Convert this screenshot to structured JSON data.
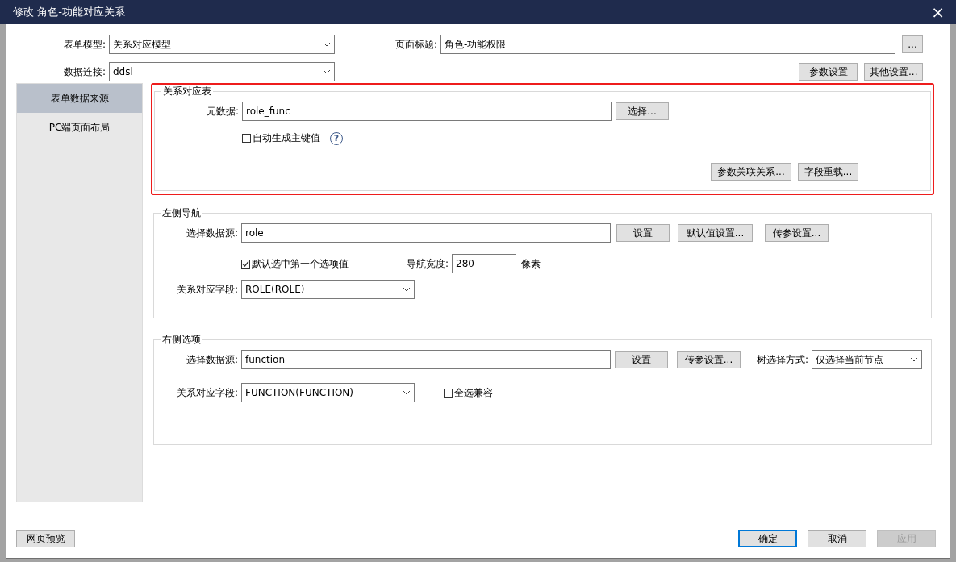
{
  "window": {
    "title": "修改 角色-功能对应关系",
    "close": "×"
  },
  "header": {
    "form_model": {
      "label": "表单模型:",
      "value": "关系对应模型"
    },
    "page_title": {
      "label": "页面标题:",
      "value": "角色-功能权限",
      "button": "..."
    },
    "data_connection": {
      "label": "数据连接:",
      "value": "ddsl"
    },
    "buttons": [
      {
        "label": "参数设置"
      },
      {
        "label": "其他设置..."
      }
    ]
  },
  "sidebar": {
    "items": [
      {
        "label": "表单数据来源",
        "selected": true
      },
      {
        "label": "PC端页面布局",
        "selected": false
      }
    ]
  },
  "relation_table": {
    "title": "关系对应表",
    "highlighted": true,
    "metadata": {
      "label": "元数据:",
      "value": "role_func",
      "button": "选择..."
    },
    "auto_key": {
      "label": "自动生成主键值",
      "checked": false
    },
    "help": "?",
    "buttons": [
      {
        "label": "参数关联关系..."
      },
      {
        "label": "字段重载..."
      }
    ]
  },
  "left_nav": {
    "title": "左侧导航",
    "data_source": {
      "label": "选择数据源:",
      "value": "role"
    },
    "buttons": [
      {
        "label": "设置"
      },
      {
        "label": "默认值设置..."
      },
      {
        "label": "传参设置..."
      }
    ],
    "default_first": {
      "label": "默认选中第一个选项值",
      "checked": true
    },
    "nav_width": {
      "label": "导航宽度:",
      "value": "280",
      "unit": "像素"
    },
    "relation_field": {
      "label": "关系对应字段:",
      "value": "ROLE(ROLE)"
    }
  },
  "right_options": {
    "title": "右侧选项",
    "data_source": {
      "label": "选择数据源:",
      "value": "function"
    },
    "buttons": [
      {
        "label": "设置"
      },
      {
        "label": "传参设置..."
      }
    ],
    "tree_mode": {
      "label": "树选择方式:",
      "value": "仅选择当前节点"
    },
    "relation_field": {
      "label": "关系对应字段:",
      "value": "FUNCTION(FUNCTION)"
    },
    "select_all_compat": {
      "label": "全选兼容",
      "checked": false
    }
  },
  "footer": {
    "preview": "网页预览",
    "buttons": [
      {
        "label": "确定",
        "default": true,
        "disabled": false
      },
      {
        "label": "取消",
        "default": false,
        "disabled": false
      },
      {
        "label": "应用",
        "default": false,
        "disabled": true
      }
    ]
  }
}
